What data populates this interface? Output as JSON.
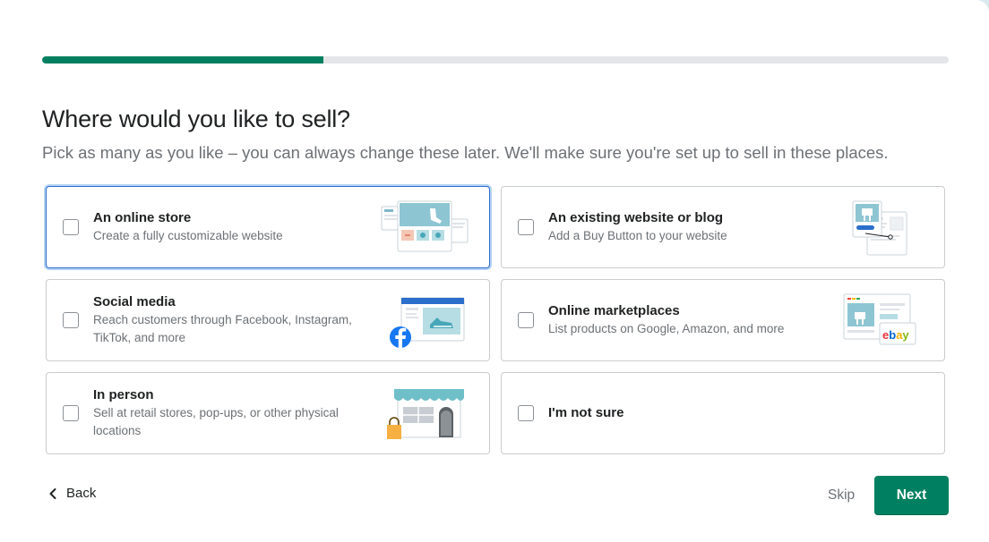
{
  "progress": {
    "value": 0.31
  },
  "header": {
    "title": "Where would you like to sell?",
    "subtitle": "Pick as many as you like – you can always change these later. We'll make sure you're set up to sell in these places."
  },
  "options": [
    {
      "title": "An online store",
      "desc": "Create a fully customizable website",
      "illustration": "online-store-illustration"
    },
    {
      "title": "An existing website or blog",
      "desc": "Add a Buy Button to your website",
      "illustration": "website-blog-illustration"
    },
    {
      "title": "Social media",
      "desc": "Reach customers through Facebook, Instagram, TikTok, and more",
      "illustration": "social-media-illustration"
    },
    {
      "title": "Online marketplaces",
      "desc": "List products on Google, Amazon, and more",
      "illustration": "marketplaces-illustration",
      "badge": "ebay"
    },
    {
      "title": "In person",
      "desc": "Sell at retail stores, pop-ups, or other physical locations",
      "illustration": "storefront-illustration"
    },
    {
      "title": "I'm not sure",
      "desc": ""
    }
  ],
  "footer": {
    "back_label": "Back",
    "skip_label": "Skip",
    "next_label": "Next"
  },
  "colors": {
    "brand": "#008060",
    "focus": "#2c6ecb",
    "border": "#c9cccf",
    "muted_text": "#6d7175"
  }
}
